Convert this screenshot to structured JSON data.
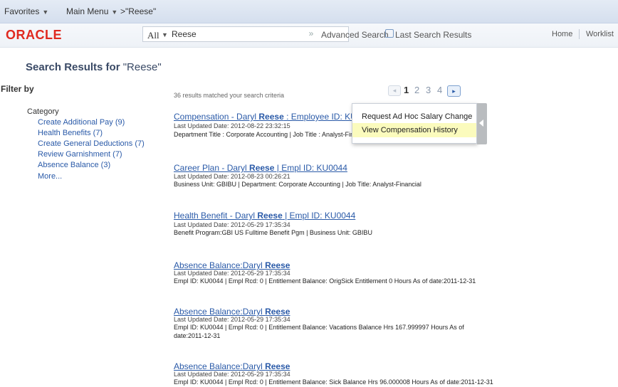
{
  "nav": {
    "favorites": "Favorites",
    "main_menu": "Main Menu",
    "breadcrumb": ">\"Reese\""
  },
  "header": {
    "logo": "ORACLE",
    "scope": "All",
    "search_value": "Reese",
    "advanced_search": "Advanced Search",
    "last_results": "Last Search Results",
    "home": "Home",
    "worklist": "Worklist"
  },
  "page": {
    "title_prefix": "Search Results for ",
    "title_query": "\"Reese\"",
    "filter_by": "Filter by",
    "category_label": "Category",
    "categories": [
      "Create Additional Pay (9)",
      "Health Benefits (7)",
      "Create General Deductions (7)",
      "Review Garnishment (7)",
      "Absence Balance (3)",
      "More..."
    ],
    "results_count": "36  results matched your search criteria"
  },
  "pager": {
    "prev": "◂",
    "pages": [
      "1",
      "2",
      "3",
      "4"
    ],
    "next": "▸"
  },
  "results": [
    {
      "title_a": "Compensation - Daryl ",
      "title_b": "Reese",
      "title_c": " : Employee ID: KU0044",
      "date": "Last Updated Date: 2012-08-22 23:32:15",
      "desc": "Department Title : Corporate Accounting | Job Title : Analyst-Finar"
    },
    {
      "title_a": "Career Plan - Daryl ",
      "title_b": "Reese",
      "title_c": " | Empl ID: KU0044",
      "date": "Last Updated Date: 2012-08-23 00:26:21",
      "desc": "Business Unit: GBIBU | Department: Corporate Accounting | Job Title: Analyst-Financial"
    },
    {
      "title_a": "Health Benefit - Daryl ",
      "title_b": "Reese",
      "title_c": " | Empl ID: KU0044",
      "date": "Last Updated Date: 2012-05-29 17:35:34",
      "desc": "Benefit Program:GBI US Fulltime Benefit Pgm | Business Unit: GBIBU"
    },
    {
      "title_a": "Absence Balance:Daryl ",
      "title_b": "Reese",
      "title_c": "",
      "date": "Last Updated Date: 2012-05-29 17:35:34",
      "desc": "Empl ID: KU0044 | Empl Rcd: 0 | Entitlement Balance: OrigSick Entitlement 0 Hours As of date:2011-12-31"
    },
    {
      "title_a": "Absence Balance:Daryl ",
      "title_b": "Reese",
      "title_c": "",
      "date": "Last Updated Date: 2012-05-29 17:35:34",
      "desc": "Empl ID: KU0044 | Empl Rcd: 0 | Entitlement Balance: Vacations Balance Hrs 167.999997 Hours As of",
      "desc2": "date:2011-12-31"
    },
    {
      "title_a": "Absence Balance:Daryl ",
      "title_b": "Reese",
      "title_c": "",
      "date": "Last Updated Date: 2012-05-29 17:35:34",
      "desc": "Empl ID: KU0044 | Empl Rcd: 0 | Entitlement Balance: Sick Balance Hrs 96.000008 Hours As of date:2011-12-31"
    }
  ],
  "popup": {
    "items": [
      "Request Ad Hoc Salary Change",
      "View Compensation History"
    ]
  }
}
